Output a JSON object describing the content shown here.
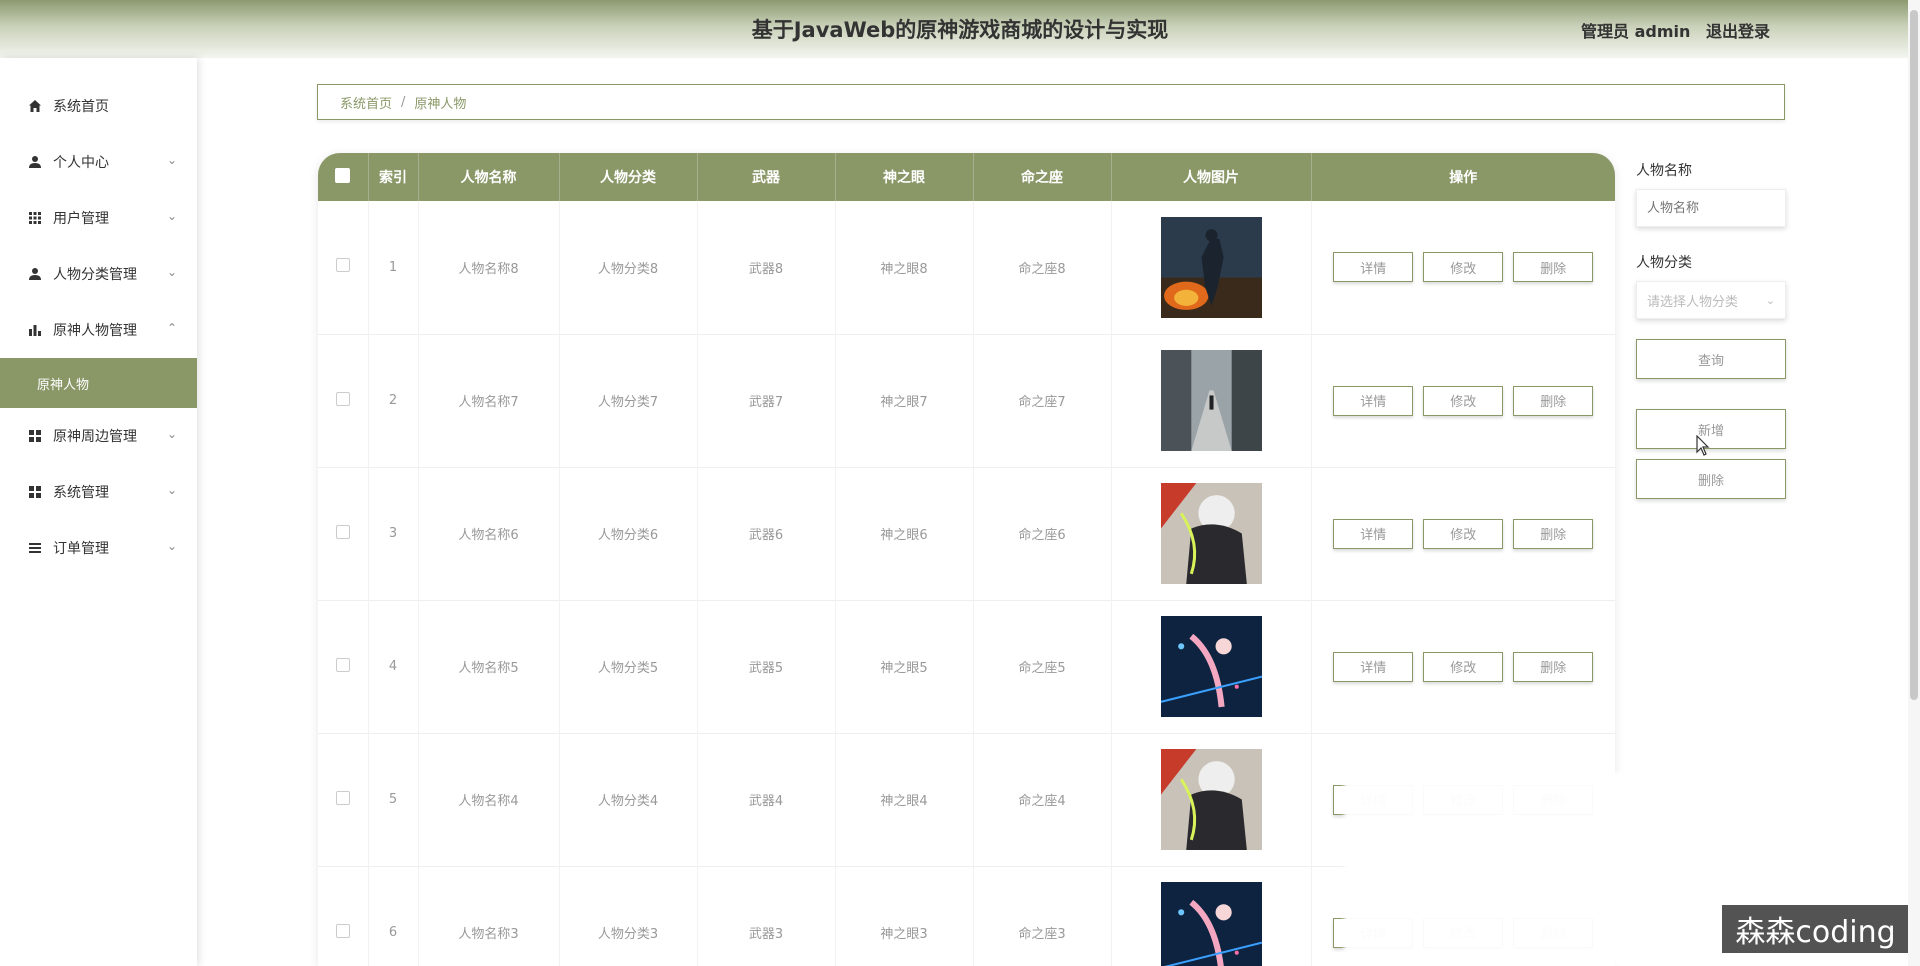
{
  "header": {
    "title": "基于JavaWeb的原神游戏商城的设计与实现",
    "user": "管理员 admin",
    "logout": "退出登录"
  },
  "sidebar": {
    "items": [
      {
        "label": "系统首页",
        "icon": "home-icon",
        "chevron": ""
      },
      {
        "label": "个人中心",
        "icon": "user-icon",
        "chevron": "⌄"
      },
      {
        "label": "用户管理",
        "icon": "grid-icon",
        "chevron": "⌄"
      },
      {
        "label": "人物分类管理",
        "icon": "user-icon",
        "chevron": "⌄"
      },
      {
        "label": "原神人物管理",
        "icon": "bar-chart-icon",
        "chevron": "⌃"
      },
      {
        "label": "原神周边管理",
        "icon": "apps-icon",
        "chevron": "⌄"
      },
      {
        "label": "系统管理",
        "icon": "apps-icon",
        "chevron": "⌄"
      },
      {
        "label": "订单管理",
        "icon": "list-icon",
        "chevron": "⌄"
      }
    ],
    "submenu_label": "原神人物"
  },
  "breadcrumb": {
    "home": "系统首页",
    "sep": "/",
    "current": "原神人物"
  },
  "table": {
    "headers": [
      "索引",
      "人物名称",
      "人物分类",
      "武器",
      "神之眼",
      "命之座",
      "人物图片",
      "操作"
    ],
    "ops": [
      "详情",
      "修改",
      "删除"
    ],
    "rows": [
      {
        "index": "1",
        "name": "人物名称8",
        "category": "人物分类8",
        "weapon": "武器8",
        "eye": "神之眼8",
        "constellation": "命之座8",
        "image": "soldier-fire"
      },
      {
        "index": "2",
        "name": "人物名称7",
        "category": "人物分类7",
        "weapon": "武器7",
        "eye": "神之眼7",
        "constellation": "命之座7",
        "image": "ruined-street"
      },
      {
        "index": "3",
        "name": "人物名称6",
        "category": "人物分类6",
        "weapon": "武器6",
        "eye": "神之眼6",
        "constellation": "命之座6",
        "image": "white-hair-warrior"
      },
      {
        "index": "4",
        "name": "人物名称5",
        "category": "人物分类5",
        "weapon": "武器5",
        "eye": "神之眼5",
        "constellation": "命之座5",
        "image": "neon-girl"
      },
      {
        "index": "5",
        "name": "人物名称4",
        "category": "人物分类4",
        "weapon": "武器4",
        "eye": "神之眼4",
        "constellation": "命之座4",
        "image": "white-hair-warrior"
      },
      {
        "index": "6",
        "name": "人物名称3",
        "category": "人物分类3",
        "weapon": "武器3",
        "eye": "神之眼3",
        "constellation": "命之座3",
        "image": "neon-girl"
      }
    ]
  },
  "search": {
    "name_label": "人物名称",
    "name_placeholder": "人物名称",
    "category_label": "人物分类",
    "category_placeholder": "请选择人物分类",
    "query": "查询",
    "add": "新增",
    "delete": "删除"
  },
  "watermark": "森森coding",
  "colors": {
    "accent": "#8a9868"
  }
}
